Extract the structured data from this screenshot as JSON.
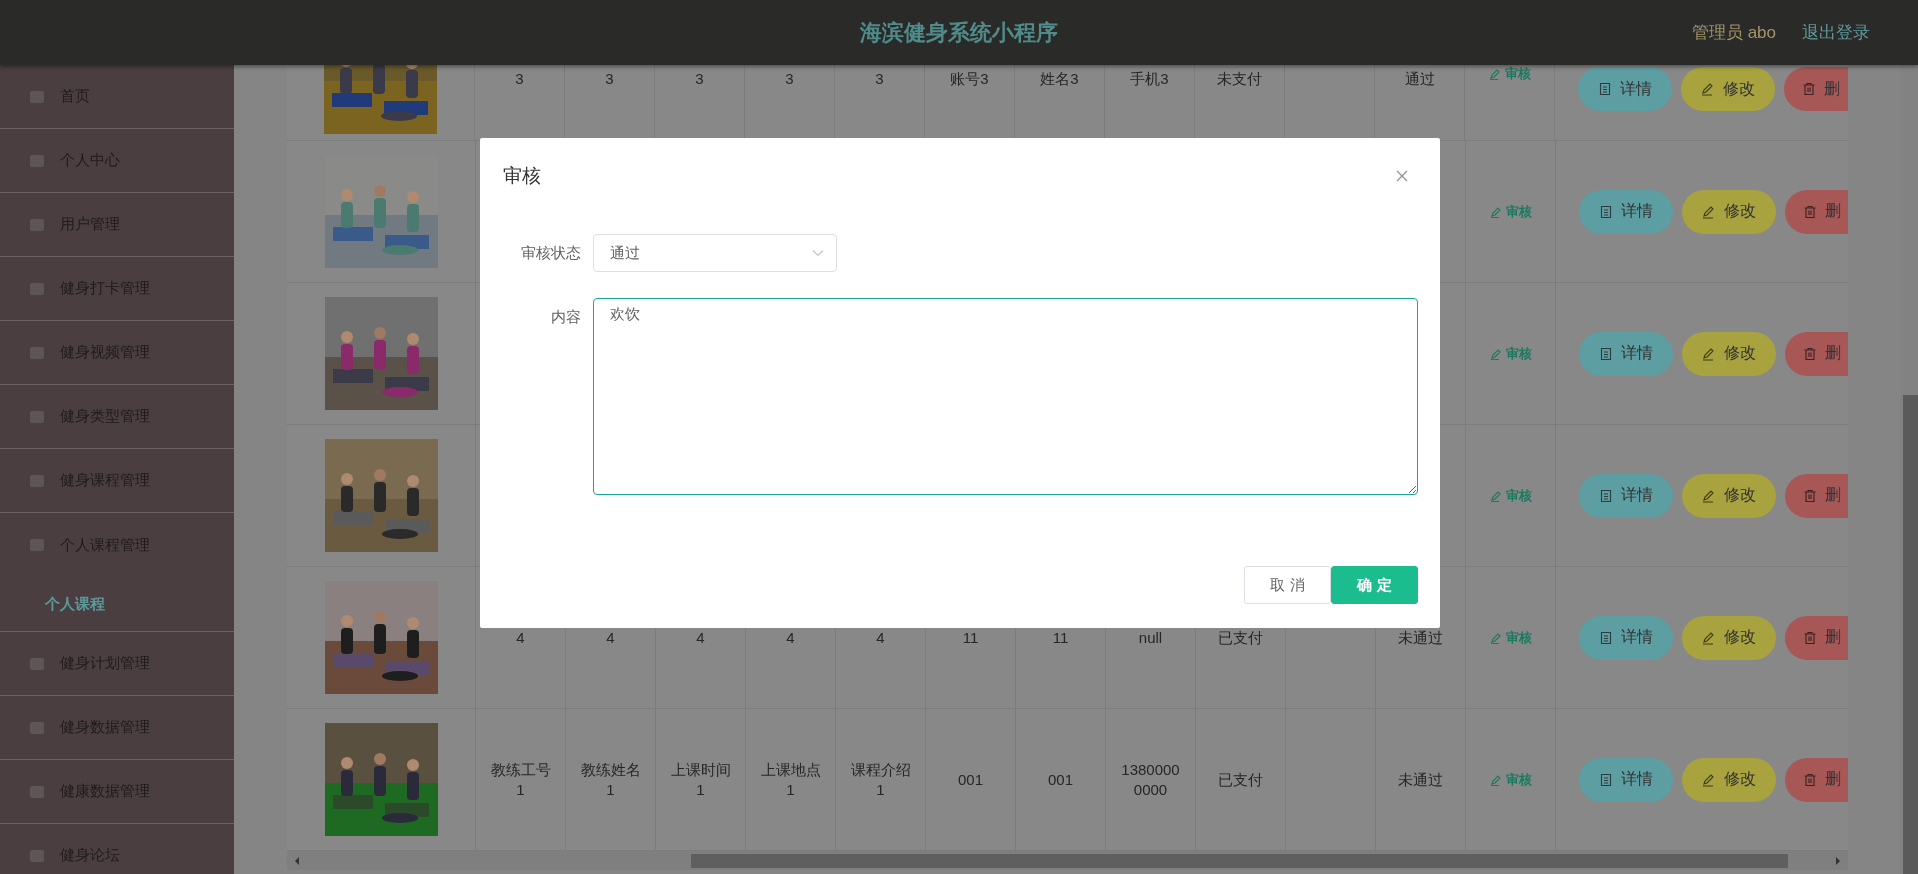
{
  "header": {
    "title": "海滨健身系统小程序",
    "user": "管理员 abo",
    "logout": "退出登录"
  },
  "sidebar": {
    "items": [
      {
        "label": "首页",
        "expanded": false
      },
      {
        "label": "个人中心",
        "expanded": false
      },
      {
        "label": "用户管理",
        "expanded": false
      },
      {
        "label": "健身打卡管理",
        "expanded": false
      },
      {
        "label": "健身视频管理",
        "expanded": false
      },
      {
        "label": "健身类型管理",
        "expanded": false
      },
      {
        "label": "健身课程管理",
        "expanded": false
      },
      {
        "label": "个人课程管理",
        "expanded": true,
        "children": [
          {
            "label": "个人课程",
            "selected": true
          }
        ]
      },
      {
        "label": "健身计划管理",
        "expanded": false
      },
      {
        "label": "健身数据管理",
        "expanded": false
      },
      {
        "label": "健康数据管理",
        "expanded": false
      },
      {
        "label": "健身论坛",
        "expanded": false
      }
    ]
  },
  "table": {
    "rows": [
      {
        "image": {
          "kind": "picture"
        },
        "cells": [
          "3",
          "3",
          "3",
          "3",
          "3",
          "账号3",
          "姓名3",
          "手机3",
          "未支付",
          null,
          "通过"
        ],
        "review_link": "审核",
        "buttons": [
          {
            "kind": "detail",
            "label": "详情"
          },
          {
            "kind": "edit",
            "label": "修改"
          },
          {
            "kind": "delete",
            "label": "删"
          }
        ]
      },
      {
        "image": {
          "kind": "picture"
        },
        "review_link": "审核",
        "buttons": [
          {
            "kind": "detail",
            "label": "详情"
          },
          {
            "kind": "edit",
            "label": "修改"
          },
          {
            "kind": "delete",
            "label": "删"
          }
        ]
      },
      {
        "image": {
          "kind": "picture"
        },
        "review_link": "审核",
        "buttons": [
          {
            "kind": "detail",
            "label": "详情"
          },
          {
            "kind": "edit",
            "label": "修改"
          },
          {
            "kind": "delete",
            "label": "删"
          }
        ]
      },
      {
        "image": {
          "kind": "picture"
        },
        "review_link": "审核",
        "buttons": [
          {
            "kind": "detail",
            "label": "详情"
          },
          {
            "kind": "edit",
            "label": "修改"
          },
          {
            "kind": "delete",
            "label": "删"
          }
        ]
      },
      {
        "image": {
          "kind": "picture"
        },
        "cells": [
          "4",
          "4",
          "4",
          "4",
          "4",
          "11",
          "11",
          "null",
          "已支付",
          null,
          "未通过"
        ],
        "review_link": "审核",
        "buttons": [
          {
            "kind": "detail",
            "label": "详情"
          },
          {
            "kind": "edit",
            "label": "修改"
          },
          {
            "kind": "delete",
            "label": "删"
          }
        ]
      },
      {
        "image": {
          "kind": "picture"
        },
        "cells": [
          "教练工号1",
          "教练姓名1",
          "上课时间1",
          "上课地点1",
          "课程介绍1",
          "001",
          "001",
          "13800000000",
          "已支付",
          null,
          "未通过"
        ],
        "review_link": "审核",
        "buttons": [
          {
            "kind": "detail",
            "label": "详情"
          },
          {
            "kind": "edit",
            "label": "修改"
          },
          {
            "kind": "delete",
            "label": "删"
          }
        ]
      }
    ]
  },
  "modal": {
    "title": "审核",
    "fields": [
      {
        "kind": "select",
        "label": "审核状态",
        "value": "通过"
      },
      {
        "kind": "textarea",
        "label": "内容",
        "value": "欢饮"
      }
    ],
    "buttons": [
      {
        "kind": "cancel",
        "label": "取消"
      },
      {
        "kind": "confirm",
        "label": "确定"
      }
    ]
  }
}
